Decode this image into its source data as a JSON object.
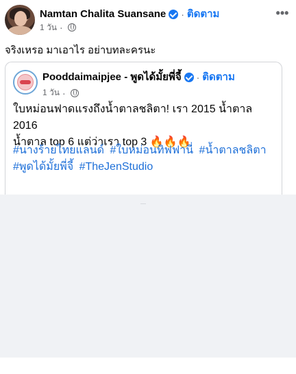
{
  "post": {
    "author_name": "Namtan Chalita Suansane",
    "follow_label": "ติดตาม",
    "dot": "·",
    "time": "1 วัน",
    "more_label": "•••",
    "caption": "จริงเหรอ มาเอาไร อย่าบทละครนะ"
  },
  "shared_post": {
    "page_name": "Pooddaimaipjee - พูดได้มั้ยพี่จี้",
    "follow_label": "ติดตาม",
    "dot": "·",
    "time": "1 วัน",
    "text_line1": "ใบหม่อนฟาดแรงถึงน้ำตาลชลิตา! เรา 2015 น้ำตาล 2016",
    "text_line2": "น้ำตาล top 6 แต่ว่าเรา top 3 🔥🔥🔥",
    "hashtags": [
      "#นางร้ายไทยแลนด์",
      "#ใบหม่อนทิฟฟานี่",
      "#น้ำตาลชลิตา",
      "#พูดได้มั้ยพี่จี้",
      "#TheJenStudio"
    ]
  },
  "icons": {
    "verified": "verified-badge-icon",
    "globe": "public-globe-icon",
    "more": "more-options-icon"
  },
  "colors": {
    "link": "#1877f2",
    "hashtag": "#1d6fd8",
    "meta": "#65676b",
    "divider_background": "#f0f2f5"
  }
}
